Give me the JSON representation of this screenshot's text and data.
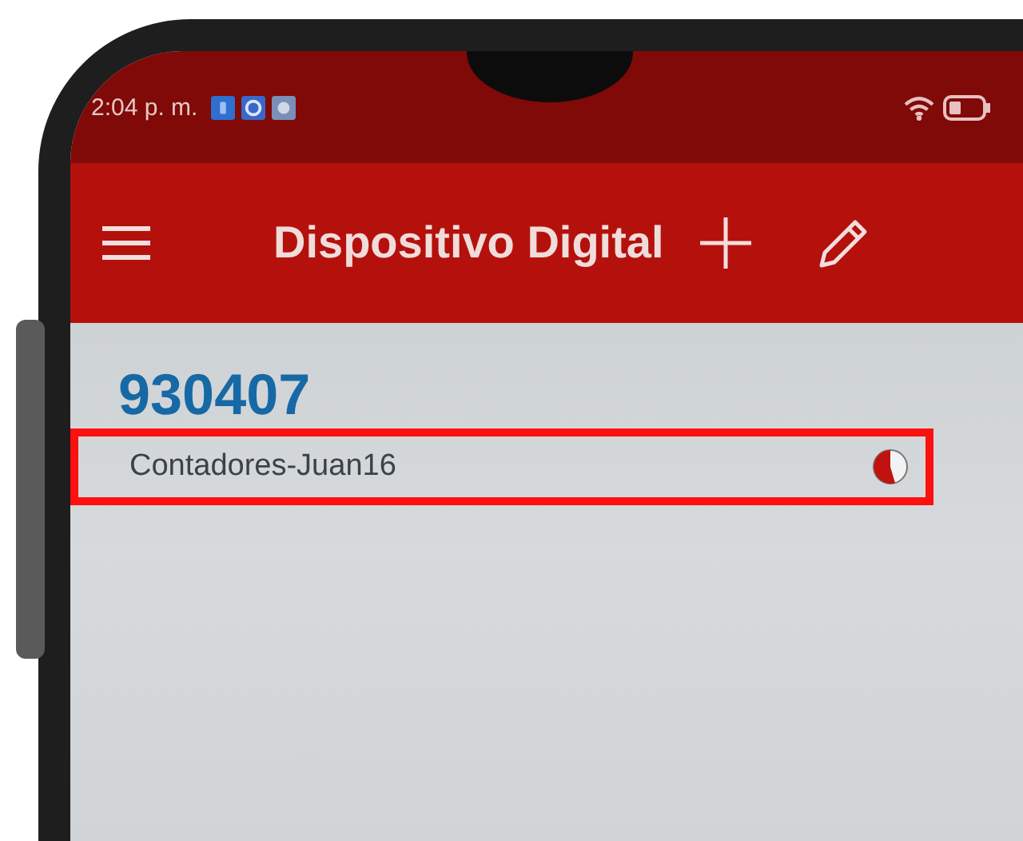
{
  "status_bar": {
    "time": "2:04 p. m."
  },
  "app_bar": {
    "title": "Dispositivo Digital"
  },
  "device": {
    "number": "930407",
    "name": "Contadores-Juan16",
    "highlighted": true
  }
}
